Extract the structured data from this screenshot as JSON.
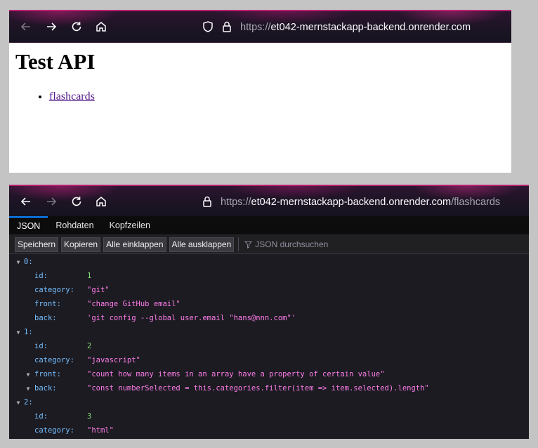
{
  "top_window": {
    "url_base": "https://",
    "url_host": "et042-mernstackapp-backend.onrender.com",
    "heading": "Test API",
    "links": [
      {
        "label": "flashcards"
      }
    ]
  },
  "bottom_window": {
    "url_base": "https://",
    "url_host": "et042-mernstackapp-backend.onrender.com",
    "url_path": "/flashcards",
    "tabs": [
      "JSON",
      "Rohdaten",
      "Kopfzeilen"
    ],
    "buttons": [
      "Speichern",
      "Kopieren",
      "Alle einklappen",
      "Alle ausklappen"
    ],
    "filter_placeholder": "JSON durchsuchen",
    "items": [
      {
        "index": "0:",
        "fields": [
          {
            "key": "id:",
            "value": "1",
            "kind": "num",
            "twisty": false
          },
          {
            "key": "category:",
            "value": "\"git\"",
            "kind": "str",
            "twisty": false
          },
          {
            "key": "front:",
            "value": "\"change GitHub email\"",
            "kind": "str",
            "twisty": false
          },
          {
            "key": "back:",
            "value": "'git config --global user.email \"hans@nnn.com\"'",
            "kind": "str",
            "twisty": false
          }
        ]
      },
      {
        "index": "1:",
        "fields": [
          {
            "key": "id:",
            "value": "2",
            "kind": "num",
            "twisty": false
          },
          {
            "key": "category:",
            "value": "\"javascript\"",
            "kind": "str",
            "twisty": false
          },
          {
            "key": "front:",
            "value": "\"count how many items in an array have a property of certain value\"",
            "kind": "str",
            "twisty": true
          },
          {
            "key": "back:",
            "value": "\"const numberSelected = this.categories.filter(item => item.selected).length\"",
            "kind": "str",
            "twisty": true
          }
        ]
      },
      {
        "index": "2:",
        "fields": [
          {
            "key": "id:",
            "value": "3",
            "kind": "num",
            "twisty": false
          },
          {
            "key": "category:",
            "value": "\"html\"",
            "kind": "str",
            "twisty": false
          }
        ]
      }
    ]
  }
}
